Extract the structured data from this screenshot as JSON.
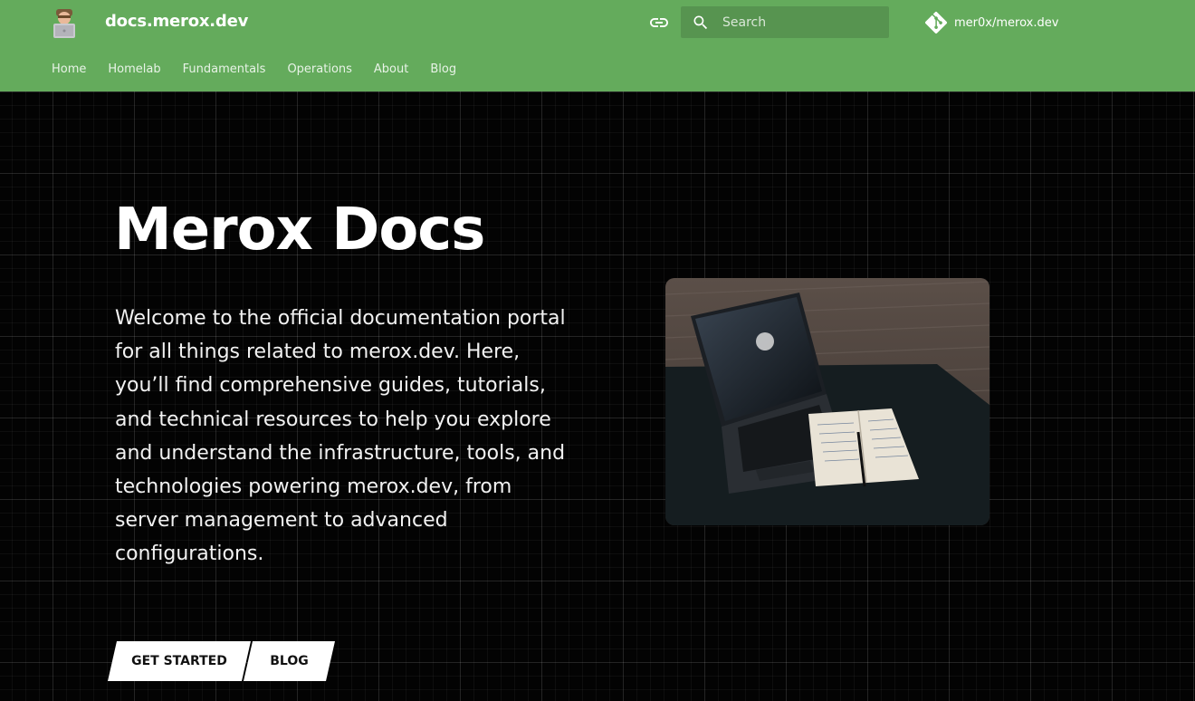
{
  "header": {
    "site_title": "docs.merox.dev",
    "search_placeholder": "Search",
    "repo_label": "mer0x/merox.dev",
    "nav": [
      "Home",
      "Homelab",
      "Fundamentals",
      "Operations",
      "About",
      "Blog"
    ]
  },
  "hero": {
    "title": "Merox Docs",
    "description": "Welcome to the official documentation portal for all things related to merox.dev. Here, you’ll find comprehensive guides, tutorials, and technical resources to help you explore and understand the infrastructure, tools, and technologies powering merox.dev, from server management to advanced configurations.",
    "buttons": {
      "get_started": "GET STARTED",
      "blog": "BLOG"
    }
  },
  "colors": {
    "header_bg": "#64ab5c",
    "hero_bg": "#030303"
  },
  "icons": [
    "avatar-logo",
    "link-icon",
    "search-icon",
    "git-icon"
  ]
}
